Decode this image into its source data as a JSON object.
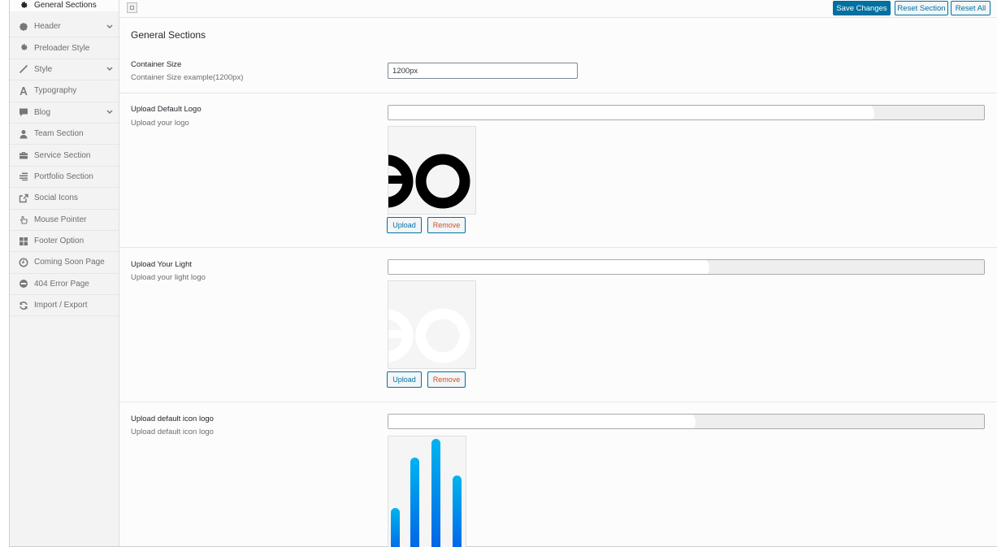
{
  "sidebar": {
    "items": [
      {
        "label": "General Sections",
        "icon": "gear-icon",
        "expandable": false
      },
      {
        "label": "Header",
        "icon": "gear-small-icon",
        "expandable": true
      },
      {
        "label": "Preloader Style",
        "icon": "cog-icon",
        "expandable": false
      },
      {
        "label": "Style",
        "icon": "brush-icon",
        "expandable": true
      },
      {
        "label": "Typography",
        "icon": "font-icon",
        "expandable": false
      },
      {
        "label": "Blog",
        "icon": "comment-icon",
        "expandable": true
      },
      {
        "label": "Team Section",
        "icon": "user-icon",
        "expandable": false
      },
      {
        "label": "Service Section",
        "icon": "briefcase-icon",
        "expandable": false
      },
      {
        "label": "Portfolio Section",
        "icon": "list-align-icon",
        "expandable": false
      },
      {
        "label": "Social Icons",
        "icon": "share-box-icon",
        "expandable": false
      },
      {
        "label": "Mouse Pointer",
        "icon": "hand-pointer-icon",
        "expandable": false
      },
      {
        "label": "Footer Option",
        "icon": "grid-icon",
        "expandable": false
      },
      {
        "label": "Coming Soon Page",
        "icon": "clock-icon",
        "expandable": false
      },
      {
        "label": "404 Error Page",
        "icon": "minus-circle-icon",
        "expandable": false
      },
      {
        "label": "Import / Export",
        "icon": "refresh-icon",
        "expandable": false
      }
    ]
  },
  "topbar": {
    "save_label": "Save Changes",
    "reset_section_label": "Reset Section",
    "reset_all_label": "Reset All"
  },
  "main": {
    "section_title": "General Sections",
    "container": {
      "label": "Container Size",
      "description": "Container Size example(1200px)",
      "value": "1200px"
    },
    "default_logo": {
      "label": "Upload Default Logo",
      "description": "Upload your logo",
      "upload_label": "Upload",
      "remove_label": "Remove"
    },
    "light_logo": {
      "label": "Upload Your Light",
      "description": "Upload your light logo",
      "upload_label": "Upload",
      "remove_label": "Remove"
    },
    "icon_logo": {
      "label": "Upload default icon logo",
      "description": "Upload default icon logo"
    }
  },
  "colors": {
    "accent": "#0071a1",
    "remove": "#d54e21",
    "icon_gradient_top": "#00b4f0",
    "icon_gradient_bottom": "#005ee6"
  }
}
